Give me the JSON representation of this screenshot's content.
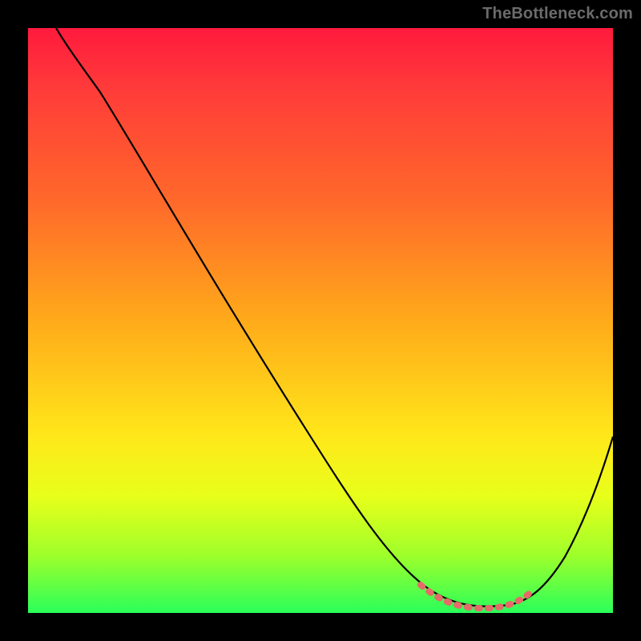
{
  "watermark": "TheBottleneck.com",
  "chart_data": {
    "type": "line",
    "title": "",
    "xlabel": "",
    "ylabel": "",
    "xlim": [
      0,
      100
    ],
    "ylim": [
      0,
      100
    ],
    "series": [
      {
        "name": "black-curve",
        "x": [
          5,
          10,
          15,
          20,
          25,
          30,
          35,
          40,
          45,
          50,
          55,
          60,
          65,
          70,
          75,
          80,
          85,
          90,
          95,
          100
        ],
        "y": [
          100,
          97,
          92,
          85,
          77,
          69,
          61,
          53,
          45,
          37,
          29,
          21,
          13,
          6,
          2,
          1,
          2,
          8,
          17,
          30
        ]
      },
      {
        "name": "pink-band",
        "x": [
          67,
          70,
          73,
          76,
          79,
          82,
          85
        ],
        "y": [
          5,
          3,
          2,
          2,
          2,
          3,
          5
        ]
      }
    ],
    "colors": {
      "curve": "#000000",
      "band": "#e66a6a",
      "gradient_top": "#ff1a3d",
      "gradient_bottom": "#2aff5a"
    }
  }
}
